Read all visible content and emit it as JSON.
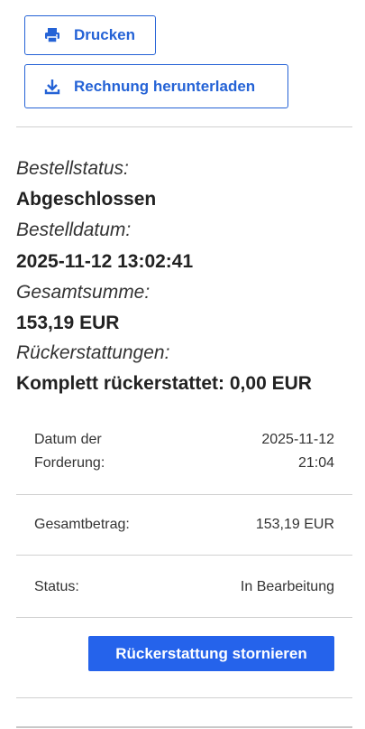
{
  "actions": {
    "print_label": "Drucken",
    "download_label": "Rechnung herunterladen"
  },
  "order": {
    "status_label": "Bestellstatus:",
    "status_value": "Abgeschlossen",
    "date_label": "Bestelldatum:",
    "date_value": "2025-11-12 13:02:41",
    "total_label": "Gesamtsumme:",
    "total_value": "153,19 EUR",
    "refunds_label": "Rückerstattungen:",
    "refunds_value": "Komplett rückerstattet: 0,00 EUR"
  },
  "refund": {
    "claim_date_label_line1": "Datum der",
    "claim_date_label_line2": "Forderung:",
    "claim_date_value_line1": "2025-11-12",
    "claim_date_value_line2": "21:04",
    "amount_label": "Gesamtbetrag:",
    "amount_value": "153,19 EUR",
    "status_label": "Status:",
    "status_value": "In Bearbeitung",
    "cancel_label": "Rückerstattung stornieren"
  },
  "colors": {
    "accent": "#2563eb",
    "divider": "#d0d0d0"
  }
}
